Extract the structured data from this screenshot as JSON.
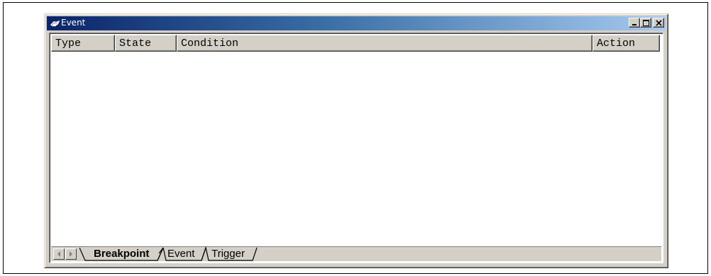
{
  "window": {
    "title": "Event",
    "title_icon": "event-window-icon",
    "controls": [
      "minimize-icon",
      "maximize-icon",
      "close-icon"
    ]
  },
  "list": {
    "columns": [
      {
        "label": "Type"
      },
      {
        "label": "State"
      },
      {
        "label": "Condition"
      },
      {
        "label": "Action"
      }
    ],
    "rows": []
  },
  "tabs": {
    "scroll_icons": [
      "scroll-left-icon",
      "scroll-right-icon"
    ],
    "items": [
      {
        "label": "Breakpoint",
        "active": true
      },
      {
        "label": "Event",
        "active": false
      },
      {
        "label": "Trigger",
        "active": false
      }
    ]
  },
  "colors": {
    "title_gradient_start": "#0a246a",
    "title_gradient_end": "#a6caf0",
    "face": "#d4d0c8"
  }
}
